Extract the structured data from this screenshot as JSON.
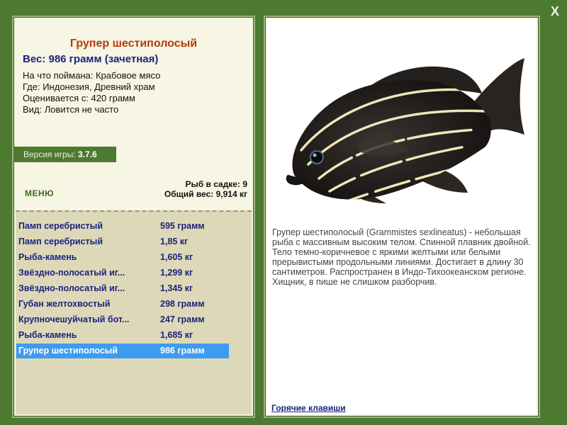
{
  "fish": {
    "title": "Групер шестиполосый",
    "weight": "Вес: 986 грамм (зачетная)",
    "bait": "На что поймана: Крабовое мясо",
    "place": "Где: Индонезия, Древний храм",
    "value": "Оценивается с: 420 грамм",
    "kind": "Вид: Ловится не часто",
    "description": "Групер шестиполосый (Grammistes sexlineatus) - небольшая рыба с массивным высоким телом. Спинной плавник двойной. Тело темно-коричневое с яркими желтыми или белыми прерывистыми продольными линиями. Достигает в длину 30 сантиметров. Распространен в Индо-Тихоокеанском регионе. Хищник, в пише не слишком разборчив."
  },
  "version": {
    "label": "Версия игры:",
    "number": "3.7.6"
  },
  "menu_label": "МЕНЮ",
  "keep": {
    "count": "Рыб в садке: 9",
    "total": "Общий вес: 9,914 кг"
  },
  "catch_list": [
    {
      "name": "Памп серебристый",
      "weight": "595 грамм"
    },
    {
      "name": "Памп серебристый",
      "weight": "1,85 кг"
    },
    {
      "name": "Рыба-камень",
      "weight": "1,605 кг"
    },
    {
      "name": "Звёздно-полосатый иг...",
      "weight": "1,299 кг"
    },
    {
      "name": "Звёздно-полосатый иг...",
      "weight": "1,345 кг"
    },
    {
      "name": "Губан желтохвостый",
      "weight": "298 грамм"
    },
    {
      "name": "Крупночешуйчатый бот...",
      "weight": "247 грамм"
    },
    {
      "name": "Рыба-камень",
      "weight": "1,685 кг"
    },
    {
      "name": "Групер шестиполосый",
      "weight": "986 грамм"
    }
  ],
  "selected_index": 8,
  "hotkeys_label": "Горячие клавиши",
  "close_label": "X",
  "icons": {
    "close": "close-icon",
    "fish": "fish-illustration"
  },
  "colors": {
    "background": "#4d7a31",
    "title": "#b53a0b",
    "list_text": "#1a237e",
    "selection": "#3d9cf0"
  }
}
